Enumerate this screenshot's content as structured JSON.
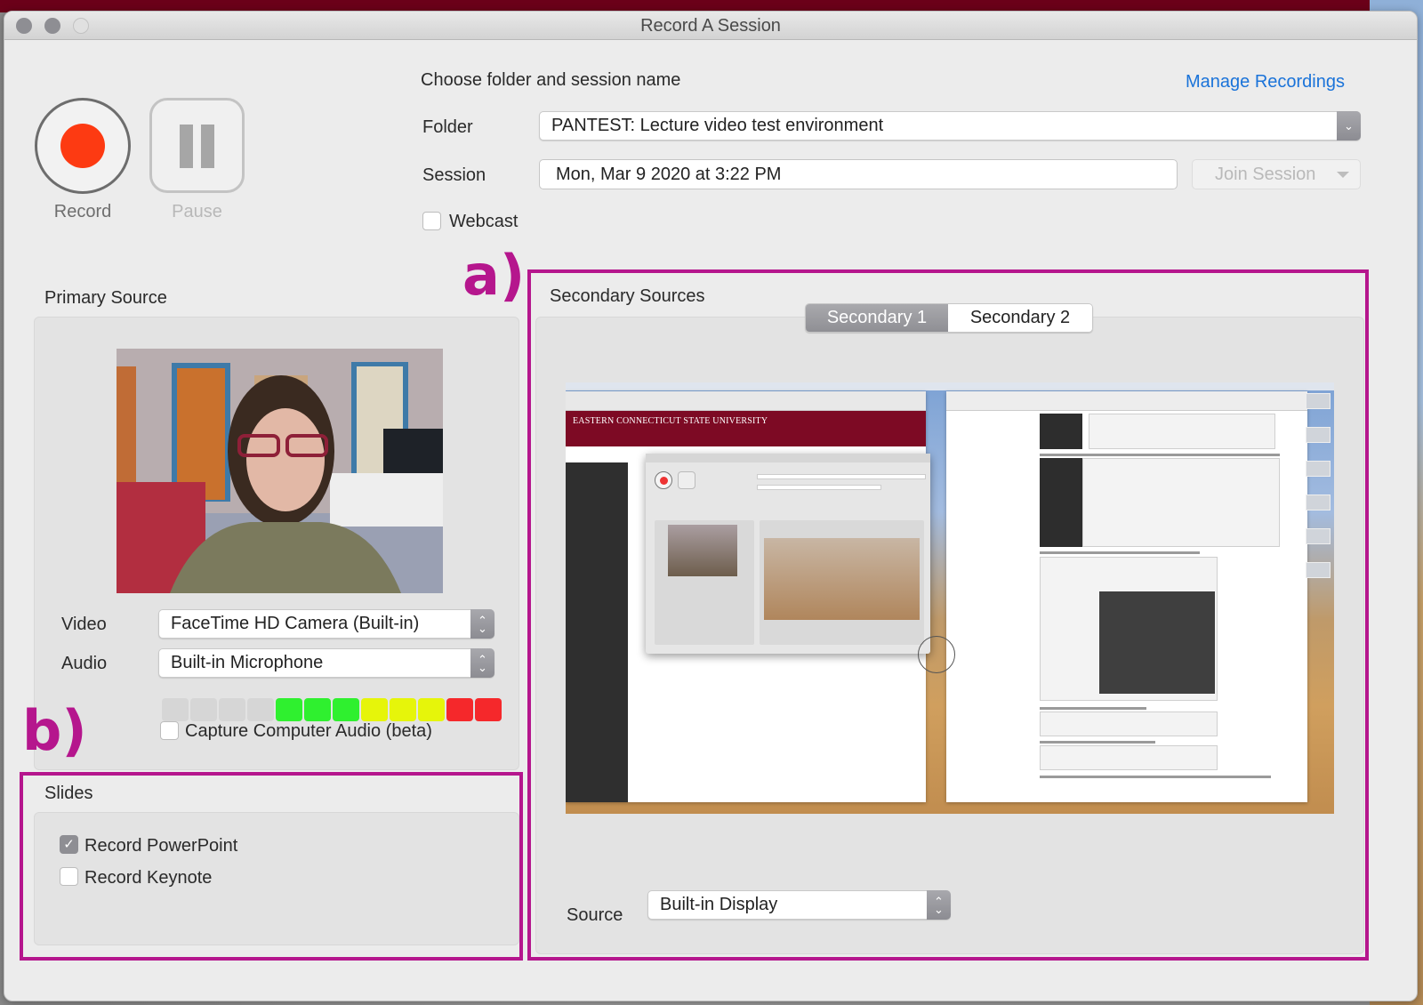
{
  "window": {
    "title": "Record A Session"
  },
  "controls": {
    "record_label": "Record",
    "pause_label": "Pause"
  },
  "session": {
    "heading": "Choose folder and session name",
    "manage_link": "Manage Recordings",
    "folder_label": "Folder",
    "folder_value": "PANTEST: Lecture video test environment",
    "session_label": "Session",
    "session_value": "Mon, Mar 9 2020 at 3:22 PM",
    "join_button": "Join Session",
    "webcast_label": "Webcast",
    "webcast_checked": false
  },
  "primary_source": {
    "heading": "Primary Source",
    "video_label": "Video",
    "video_value": "FaceTime HD Camera (Built-in)",
    "audio_label": "Audio",
    "audio_value": "Built-in Microphone",
    "audio_level": {
      "segments_total": 12,
      "segments_lit": 8,
      "segment_colors": [
        "#d6d6d6",
        "#d6d6d6",
        "#d6d6d6",
        "#d6d6d6",
        "#2ff02f",
        "#2ff02f",
        "#2ff02f",
        "#e6f50a",
        "#e6f50a",
        "#e6f50a",
        "#f5282b",
        "#f5282b"
      ]
    },
    "capture_audio_label": "Capture Computer Audio (beta)",
    "capture_audio_checked": false
  },
  "slides": {
    "heading": "Slides",
    "items": [
      {
        "label": "Record PowerPoint",
        "checked": true
      },
      {
        "label": "Record Keynote",
        "checked": false
      }
    ]
  },
  "secondary_sources": {
    "heading": "Secondary Sources",
    "tabs": [
      {
        "label": "Secondary 1",
        "active": true
      },
      {
        "label": "Secondary 2",
        "active": false
      }
    ],
    "preview": {
      "banner_text": "EASTERN CONNECTICUT STATE UNIVERSITY"
    },
    "source_label": "Source",
    "source_value": "Built-in Display"
  },
  "annotations": {
    "a_label": "a)",
    "b_label": "b)",
    "color": "#b5168d"
  },
  "colors": {
    "record_red": "#fd3a12",
    "link_blue": "#1a73d9"
  }
}
